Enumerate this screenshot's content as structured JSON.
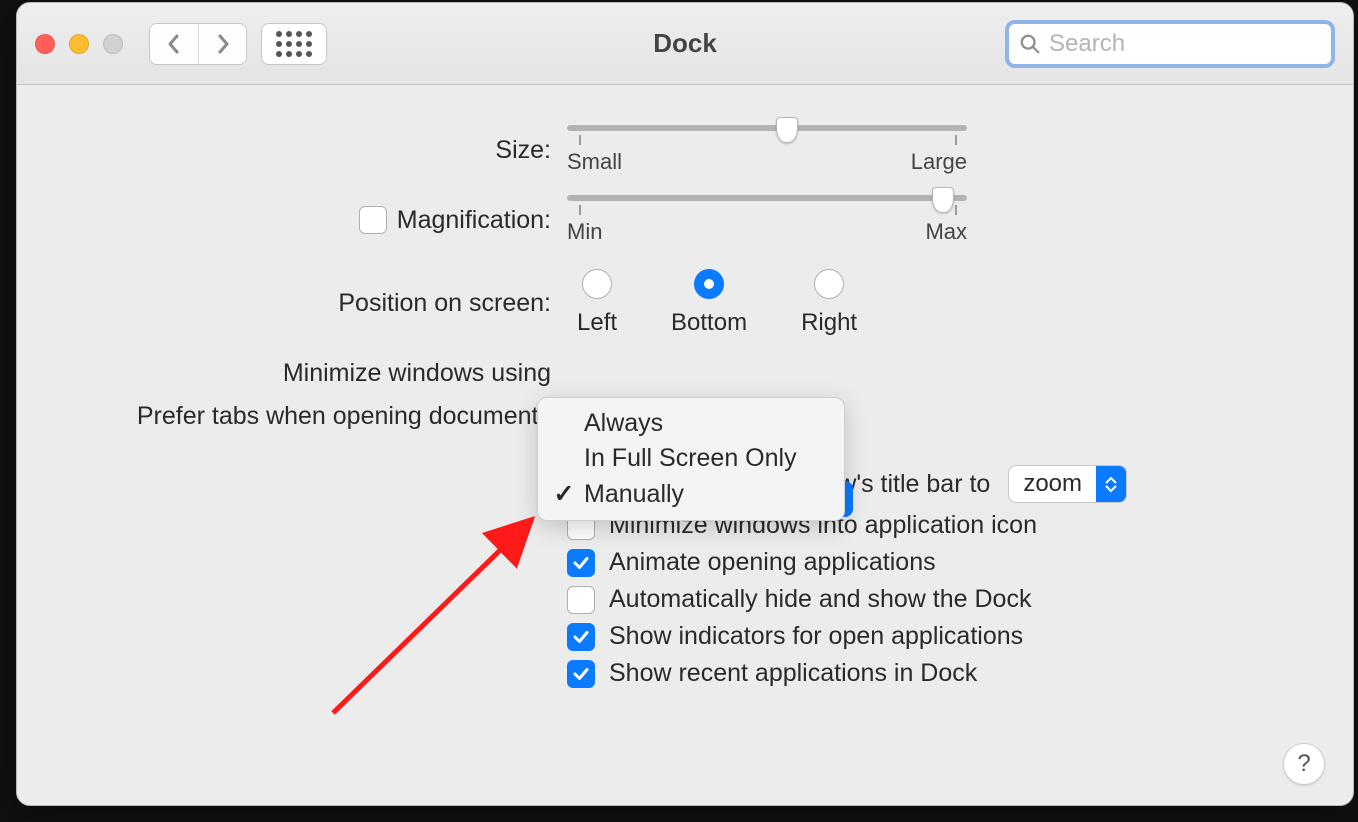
{
  "title": "Dock",
  "search": {
    "placeholder": "Search"
  },
  "size": {
    "label": "Size:",
    "min_label": "Small",
    "max_label": "Large",
    "value_pct": 55
  },
  "magnification": {
    "label": "Magnification:",
    "checked": false,
    "min_label": "Min",
    "max_label": "Max",
    "value_pct": 94
  },
  "position": {
    "label": "Position on screen:",
    "options": {
      "left": "Left",
      "bottom": "Bottom",
      "right": "Right"
    },
    "selected": "bottom"
  },
  "minimize_using": {
    "label": "Minimize windows using"
  },
  "prefer_tabs": {
    "label": "Prefer tabs when opening documents",
    "menu": {
      "always": "Always",
      "full_screen": "In Full Screen Only",
      "manually": "Manually"
    },
    "selected": "manually"
  },
  "double_click": {
    "label": "Double-click a window's title bar to",
    "checked": true,
    "dropdown_value": "zoom"
  },
  "options": {
    "minimize_into_app": {
      "label": "Minimize windows into application icon",
      "checked": false
    },
    "animate_opening": {
      "label": "Animate opening applications",
      "checked": true
    },
    "autohide": {
      "label": "Automatically hide and show the Dock",
      "checked": false
    },
    "indicators": {
      "label": "Show indicators for open applications",
      "checked": true
    },
    "recent_apps": {
      "label": "Show recent applications in Dock",
      "checked": true
    }
  },
  "help": "?"
}
